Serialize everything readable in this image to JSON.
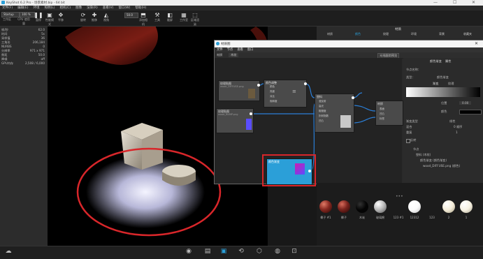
{
  "window": {
    "title": "KeyShot 6.2 Pro - 场景素材.bip - 64 bit",
    "minimize": "—",
    "maximize": "☐",
    "close": "✕"
  },
  "menu": [
    "文件(F)",
    "编辑(E)",
    "环境",
    "照明(L)",
    "相机(C)",
    "图像",
    "渲染(R)",
    "查看(V)",
    "窗口(W)",
    "帮助(H)"
  ],
  "toolbar": {
    "workspace_select": "Startup",
    "cpu_select": "100 %",
    "items": [
      {
        "icon": "play-icon",
        "label": "工作区"
      },
      {
        "icon": "cpu-icon",
        "label": "CPU 使用量"
      },
      {
        "icon": "pause-icon",
        "label": "暂停"
      },
      {
        "icon": "gpu-icon",
        "label": "性能模式"
      },
      {
        "icon": "translate-icon",
        "label": "平移"
      },
      {
        "icon": "rotate-icon",
        "label": "旋转"
      },
      {
        "icon": "zoom-icon",
        "label": "推移"
      },
      {
        "icon": "fov-icon",
        "label": "视角"
      },
      {
        "icon": "scene-icon",
        "label": "添加相机"
      },
      {
        "icon": "tools-icon",
        "label": "工具"
      },
      {
        "icon": "render-icon",
        "label": "截屏"
      },
      {
        "icon": "config-icon",
        "label": "工作室"
      },
      {
        "icon": "region-icon",
        "label": "区域渲染"
      }
    ],
    "fov_value": "50.0"
  },
  "left_panel": {
    "rows": [
      {
        "label": "帧/秒",
        "value": "62.0"
      },
      {
        "label": "时间",
        "value": "5s"
      },
      {
        "label": "采样值",
        "value": "36"
      },
      {
        "label": "三角形",
        "value": "206,184"
      },
      {
        "label": "NURBS",
        "value": "0"
      },
      {
        "label": "分辨率",
        "value": "971 x 971"
      },
      {
        "label": "焦距",
        "value": "50.0"
      },
      {
        "label": "降噪",
        "value": "off"
      },
      {
        "label": "GPU内存",
        "value": "2,508 / 6,000"
      }
    ]
  },
  "node_window": {
    "title": "材质图",
    "menu": [
      "文件",
      "节点",
      "查看",
      "窗口"
    ],
    "sub": {
      "label": "材质",
      "value": "木纹"
    },
    "preview_button": "光线跟踪预览",
    "nodes": [
      {
        "title": "纹理贴图",
        "sub": "wood_DIFFUSE.png"
      },
      {
        "title": "颜色调整",
        "sub": ""
      },
      {
        "title": "纹理贴图",
        "sub": "wood_BUMP.png"
      },
      {
        "title": "颜色渐变",
        "sub": ""
      },
      {
        "title": "塑料",
        "sub": ""
      },
      {
        "title": "材质",
        "sub": ""
      }
    ],
    "ports": {
      "adjust": [
        "颜色",
        "亮度",
        "对比",
        "饱和度"
      ],
      "plastic": [
        "漫反射",
        "高光",
        "粗糙度",
        "折射指数",
        "凹凸"
      ],
      "material": [
        "表面",
        "凹凸",
        "标签"
      ]
    }
  },
  "props_panel": {
    "tabs": [
      "颜色渐变",
      "属性"
    ],
    "node_name_label": "节点名称：",
    "type_label": "类型：",
    "type_value": "颜色渐变",
    "sub_tabs": [
      "渐变",
      "纹理"
    ],
    "position_label": "位置",
    "position_value": "0.00",
    "color_label": "颜色",
    "interp_label": "渐变类型",
    "interp_value": "线性",
    "blend_label": "混合",
    "blend_value": "0 顺序",
    "repeat_label": "重复",
    "repeat_value": "1",
    "invert_label": "反转",
    "tree_title": "节点",
    "tree_items": [
      "塑料 (木纹)",
      "颜色渐变 (颜色渐变)",
      "wood_DIFFUSE.png (颜色)"
    ]
  },
  "library": {
    "tabs": [
      "材质",
      "颜色",
      "纹理",
      "环境",
      "背景",
      "收藏夹"
    ],
    "title": "材质",
    "materials": [
      {
        "name": "椰子 #1",
        "color": "#8a2a22"
      },
      {
        "name": "椰子",
        "color": "#7a241e"
      },
      {
        "name": "木炭",
        "color": "#050505"
      },
      {
        "name": "玻璃棉",
        "color": "#bdbdbd"
      },
      {
        "name": "123 #1",
        "color": "#f0f0f0"
      },
      {
        "name": "12312",
        "color": "#fafafa"
      },
      {
        "name": "123",
        "color": "#f2efe8"
      },
      {
        "name": "2",
        "color": "#f3ecd8"
      },
      {
        "name": "1",
        "color": "#f7f2e2"
      }
    ]
  },
  "status": {
    "items": [
      "云库",
      "库",
      "项目",
      "动画",
      "KeyShotVR",
      "渲染",
      "截屏"
    ]
  },
  "colors": {
    "highlight_red": "#d8262a",
    "accent_blue": "#2b9fd8",
    "node_pink": "#d01ab0",
    "node_violet": "#5a4dff"
  }
}
